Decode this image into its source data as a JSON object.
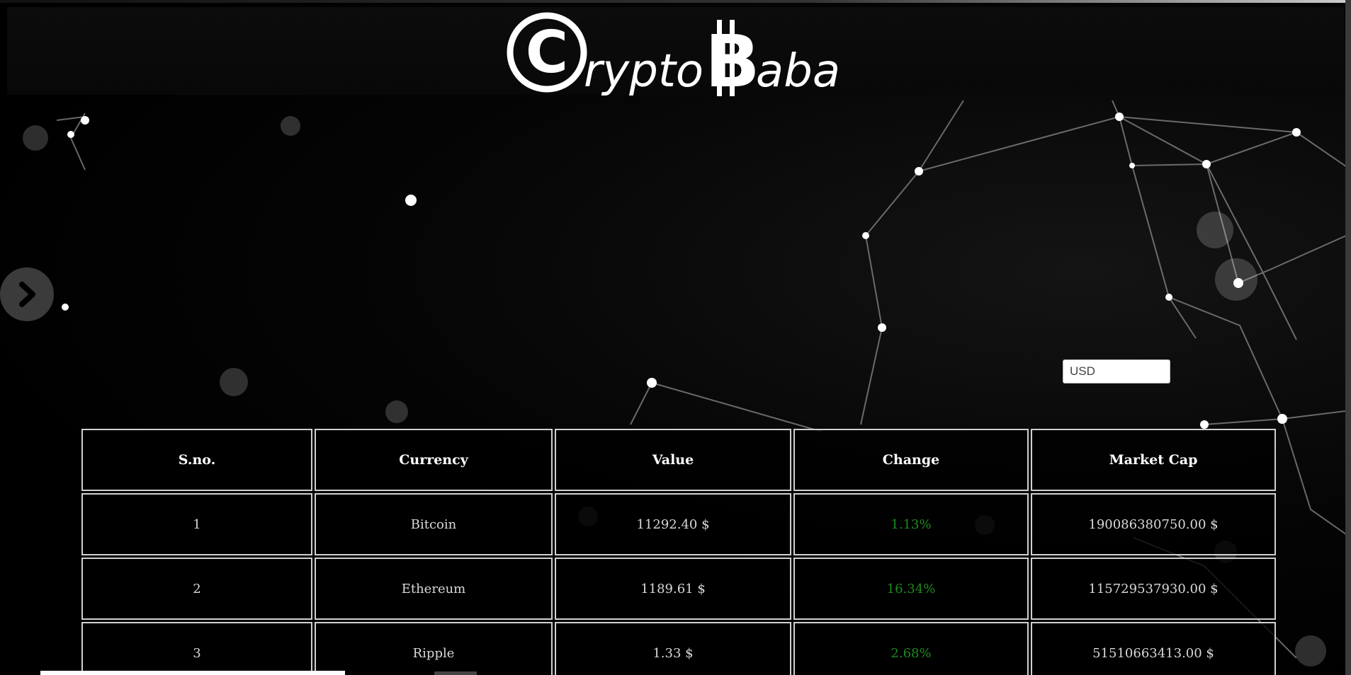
{
  "header": {
    "logo_text": "CryptoBaba"
  },
  "controls": {
    "currency_selected": "USD"
  },
  "table": {
    "headers": [
      "S.no.",
      "Currency",
      "Value",
      "Change",
      "Market Cap"
    ],
    "rows": [
      {
        "sno": "1",
        "currency": "Bitcoin",
        "value": "11292.40 $",
        "change": "1.13%",
        "market_cap": "190086380750.00 $"
      },
      {
        "sno": "2",
        "currency": "Ethereum",
        "value": "1189.61 $",
        "change": "16.34%",
        "market_cap": "115729537930.00 $"
      },
      {
        "sno": "3",
        "currency": "Ripple",
        "value": "1.33 $",
        "change": "2.68%",
        "market_cap": "51510663413.00 $"
      }
    ]
  },
  "colors": {
    "background": "#000000",
    "text": "#d8d8d8",
    "change_positive": "#1f8a1f",
    "border": "#d0d0d0"
  },
  "icons": {
    "nav_arrow": "chevron-right-icon"
  }
}
